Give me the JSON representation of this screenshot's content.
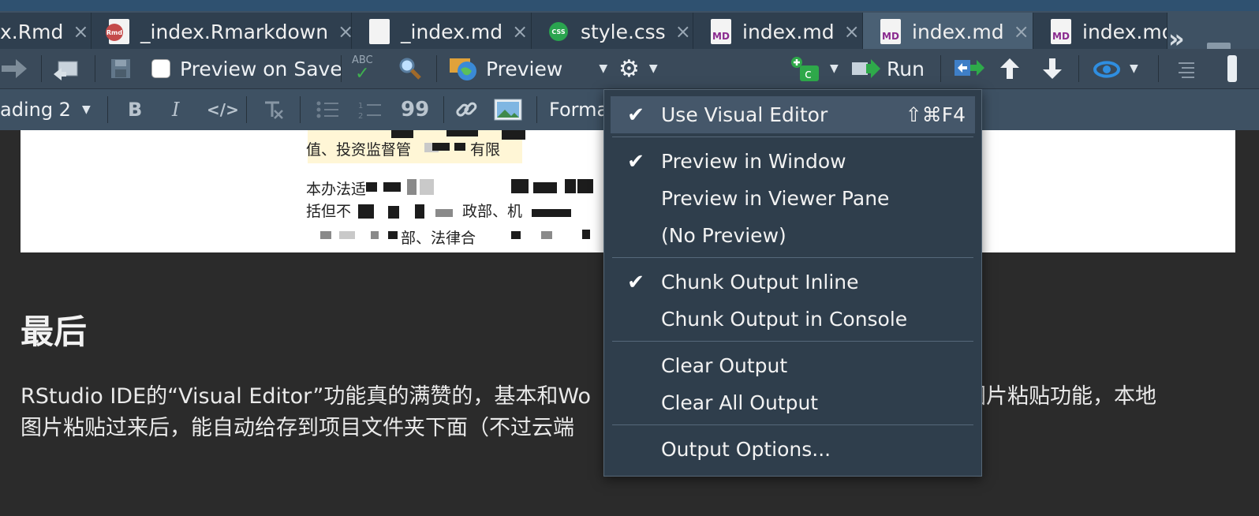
{
  "tabs": [
    {
      "label": "x.Rmd",
      "icon": "none"
    },
    {
      "label": "_index.Rmarkdown",
      "icon": "rmd-file-icon"
    },
    {
      "label": "_index.md",
      "icon": "blank-file-icon"
    },
    {
      "label": "style.css",
      "icon": "css-file-icon"
    },
    {
      "label": "index.md",
      "icon": "md-file-icon"
    },
    {
      "label": "index.md",
      "icon": "md-file-icon"
    },
    {
      "label": "index.md",
      "icon": "md-file-icon"
    }
  ],
  "tab_close_glyph": "×",
  "tab_overflow_glyph": "»",
  "toolbar": {
    "preview_on_save_label": "Preview on Save",
    "spellcheck_badge": "ABC",
    "preview_label": "Preview",
    "run_label": "Run"
  },
  "formatbar": {
    "heading_select": "ading 2",
    "bold": "B",
    "italic": "I",
    "code": "</>",
    "quote": "99",
    "format_menu": "Forma"
  },
  "document_preview": {
    "line1": "值、投资监督管",
    "line1_tail": "有限",
    "line2": "本办法适",
    "line3": "括但不",
    "line3_mid": "政部、机",
    "line4": "部、法律合"
  },
  "content": {
    "heading": "最后",
    "paragraph_line1_a": "RStudio IDE的“Visual Editor”功能真的满赞的，基本和Wo",
    "paragraph_line1_b": "个图片粘贴功能，本地",
    "paragraph_line2_a": "图片粘贴过来后，能自动给存到项目文件夹下面（不过云端"
  },
  "menu": {
    "items": [
      {
        "label": "Use Visual Editor",
        "checked": true,
        "shortcut": "⇧⌘F4"
      },
      {
        "label": "Preview in Window",
        "checked": true
      },
      {
        "label": "Preview in Viewer Pane",
        "checked": false
      },
      {
        "label": "(No Preview)",
        "checked": false
      },
      {
        "label": "Chunk Output Inline",
        "checked": true
      },
      {
        "label": "Chunk Output in Console",
        "checked": false
      },
      {
        "label": "Clear Output",
        "checked": false
      },
      {
        "label": "Clear All Output",
        "checked": false
      },
      {
        "label": "Output Options...",
        "checked": false
      }
    ],
    "check_glyph": "✔"
  },
  "colors": {
    "tabbar": "#3e5163",
    "active_tab": "#4a6074",
    "menu_bg": "#2f3e4c",
    "menu_hover": "#45576a",
    "content_bg": "#2b2b2b"
  }
}
